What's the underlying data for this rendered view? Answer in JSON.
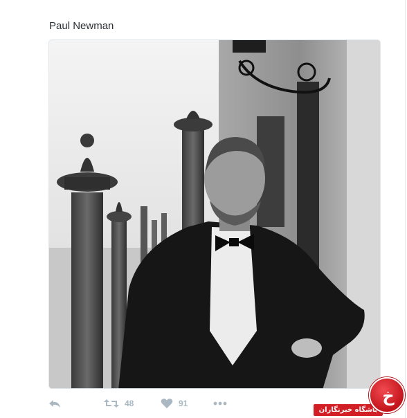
{
  "tweet": {
    "text": "Paul Newman"
  },
  "actions": {
    "reply_icon": "reply-icon",
    "retweet_icon": "retweet-icon",
    "retweet_count": "48",
    "like_icon": "heart-icon",
    "like_count": "91",
    "more_icon": "more-dots-icon"
  },
  "watermark": {
    "text": "باشگاه خبرنگاران",
    "logo_glyph": "خ"
  },
  "colors": {
    "text": "#292f33",
    "action_gray": "#aab8c2",
    "border": "#e1e8ed",
    "watermark_red": "#d21f26"
  }
}
